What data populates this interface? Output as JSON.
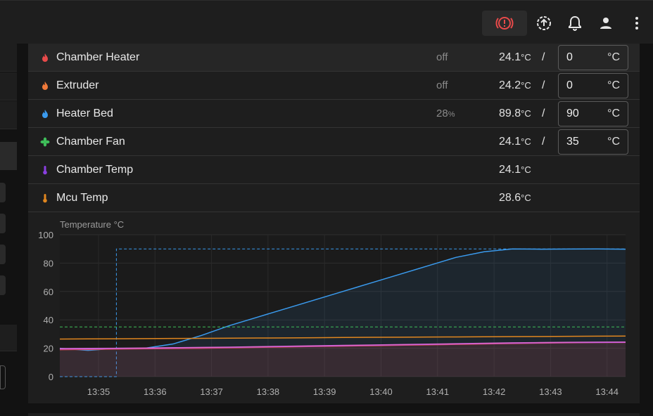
{
  "toolbar": {
    "icons": [
      "emergency-stop-icon",
      "upload-icon",
      "bell-icon",
      "account-icon",
      "more-vert-icon"
    ]
  },
  "sensors": [
    {
      "name": "Chamber Heater",
      "icon": "flame-icon",
      "icon_color": "#e84a4a",
      "power": "off",
      "power_unit": "",
      "temp": "24.1",
      "temp_unit": "°C",
      "slash": "/",
      "target": "0",
      "target_unit": "°C"
    },
    {
      "name": "Extruder",
      "icon": "flame-icon",
      "icon_color": "#f07a3a",
      "power": "off",
      "power_unit": "",
      "temp": "24.2",
      "temp_unit": "°C",
      "slash": "/",
      "target": "0",
      "target_unit": "°C"
    },
    {
      "name": "Heater Bed",
      "icon": "flame-icon",
      "icon_color": "#3a9bef",
      "power": "28",
      "power_unit": "%",
      "temp": "89.8",
      "temp_unit": "°C",
      "slash": "/",
      "target": "90",
      "target_unit": "°C"
    },
    {
      "name": "Chamber Fan",
      "icon": "fan-icon",
      "icon_color": "#3fbf5a",
      "power": "",
      "power_unit": "",
      "temp": "24.1",
      "temp_unit": "°C",
      "slash": "/",
      "target": "35",
      "target_unit": "°C"
    },
    {
      "name": "Chamber Temp",
      "icon": "thermometer-icon",
      "icon_color": "#8a3fe0",
      "power": "",
      "power_unit": "",
      "temp": "24.1",
      "temp_unit": "°C"
    },
    {
      "name": "Mcu Temp",
      "icon": "thermometer-icon",
      "icon_color": "#e0861f",
      "power": "",
      "power_unit": "",
      "temp": "28.6",
      "temp_unit": "°C"
    }
  ],
  "chart_data": {
    "type": "line",
    "title": "Temperature °C",
    "xlabel": "",
    "ylabel": "",
    "ylim": [
      0,
      100
    ],
    "yticks": [
      "0",
      "20",
      "40",
      "60",
      "80",
      "100"
    ],
    "xticks": [
      "13:35",
      "13:36",
      "13:37",
      "13:38",
      "13:39",
      "13:40",
      "13:41",
      "13:42",
      "13:43",
      "13:44"
    ],
    "x_minutes": [
      0,
      0.5,
      1,
      1.5,
      2,
      2.5,
      3,
      3.5,
      4,
      4.5,
      5,
      5.5,
      6,
      6.5,
      7,
      7.5,
      8,
      8.5,
      9,
      9.5,
      10
    ],
    "grid": true,
    "legend": "none",
    "series": [
      {
        "color": "#3a9bef",
        "values": [
          20,
          18.5,
          20,
          20,
          23,
          29,
          36,
          42,
          48,
          54,
          60,
          66,
          72,
          78,
          84,
          88,
          90,
          89.8,
          89.9,
          90,
          89.8
        ],
        "fill": true
      },
      {
        "color": "#3a9bef",
        "dashed": true,
        "values": [
          0,
          0,
          90,
          90,
          90,
          90,
          90,
          90,
          90,
          90,
          90,
          90,
          90,
          90,
          90,
          90,
          90,
          90,
          90,
          90,
          90
        ]
      },
      {
        "color": "#3fbf5a",
        "dashed": true,
        "values": [
          35,
          35,
          35,
          35,
          35,
          35,
          35,
          35,
          35,
          35,
          35,
          35,
          35,
          35,
          35,
          35,
          35,
          35,
          35,
          35,
          35
        ]
      },
      {
        "color": "#e0861f",
        "values": [
          26.5,
          26.6,
          26.7,
          26.8,
          26.9,
          27,
          27.1,
          27.2,
          27.3,
          27.4,
          27.6,
          27.7,
          27.8,
          27.9,
          28,
          28.1,
          28.2,
          28.3,
          28.4,
          28.5,
          28.6
        ]
      },
      {
        "color": "#e84a4a",
        "values": [
          19,
          19.2,
          19.4,
          19.6,
          19.8,
          20,
          20.3,
          20.6,
          20.9,
          21.2,
          21.5,
          21.8,
          22.1,
          22.4,
          22.7,
          23,
          23.3,
          23.6,
          23.8,
          24,
          24.1
        ],
        "fill": true
      },
      {
        "color": "#8a3fe0",
        "values": [
          19.5,
          19.6,
          19.8,
          20,
          20.2,
          20.4,
          20.6,
          20.9,
          21.2,
          21.5,
          21.8,
          22.1,
          22.4,
          22.7,
          23,
          23.3,
          23.6,
          23.8,
          24,
          24.1,
          24.2
        ]
      },
      {
        "color": "#e06ad0",
        "values": [
          19.8,
          19.9,
          20,
          20.2,
          20.4,
          20.6,
          20.8,
          21.1,
          21.4,
          21.7,
          22,
          22.3,
          22.6,
          22.9,
          23.2,
          23.5,
          23.8,
          24,
          24.2,
          24.3,
          24.4
        ]
      }
    ]
  }
}
